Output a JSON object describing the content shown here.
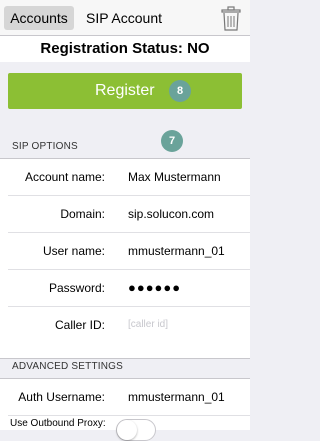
{
  "topbar": {
    "accounts_tab": "Accounts",
    "sip_account_tab": "SIP Account",
    "trash_icon": "trash-icon"
  },
  "status": {
    "text": "Registration Status: NO"
  },
  "register": {
    "label": "Register",
    "badge": "8",
    "color": "#8cbf34"
  },
  "sip_options": {
    "header": "SIP OPTIONS",
    "badge": "7",
    "rows": [
      {
        "label": "Account name:",
        "value": "Max Mustermann"
      },
      {
        "label": "Domain:",
        "value": "sip.solucon.com"
      },
      {
        "label": "User name:",
        "value": "mmustermann_01"
      },
      {
        "label": "Password:",
        "value": "●●●●●●"
      },
      {
        "label": "Caller ID:",
        "placeholder": "[caller id]"
      }
    ]
  },
  "advanced": {
    "header": "ADVANCED SETTINGS",
    "rows": [
      {
        "label": "Auth Username:",
        "value": "mmustermann_01"
      },
      {
        "label": "Use Outbound Proxy:",
        "toggle_on": false
      }
    ]
  },
  "colors": {
    "badge": "#6aa39a",
    "background": "#efeff4"
  }
}
